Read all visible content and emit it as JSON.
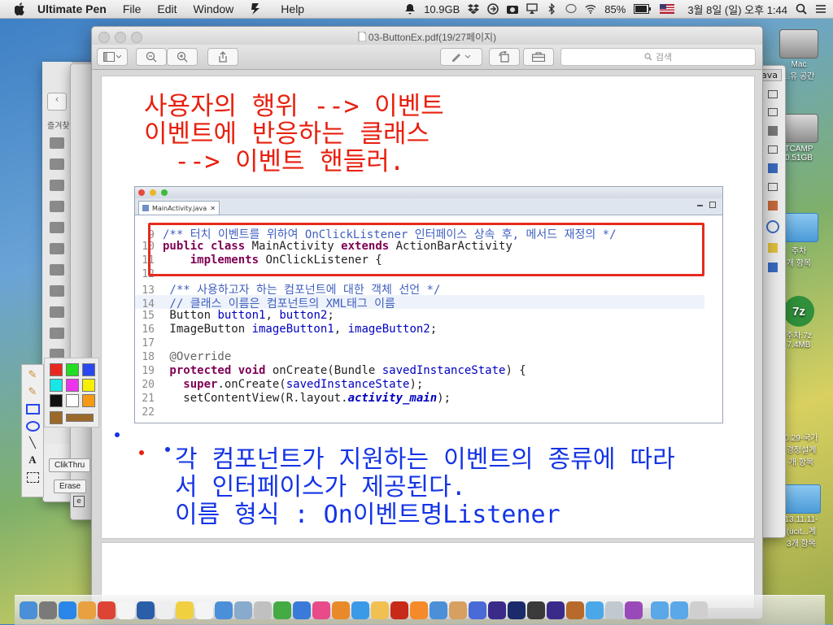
{
  "menubar": {
    "app_name": "Ultimate Pen",
    "menus": [
      "File",
      "Edit",
      "Window",
      "Help"
    ],
    "status": {
      "disk": "10.9GB",
      "battery": "85%",
      "datetime": "3월 8일 (일) 오후 1:44"
    }
  },
  "desktop": {
    "icons": [
      {
        "label": "Mac",
        "sub": "...유 공간"
      },
      {
        "label": "TCAMP",
        "sub": "0.51GB"
      },
      {
        "label": "주차",
        "sub": "개 항목"
      },
      {
        "label": "주차.7z",
        "sub": "7.4MB",
        "badge": "7z"
      },
      {
        "label": "0.29-국가",
        "sub": "경정설계"
      },
      {
        "label": "13.11.11-",
        "sub": "(ucit...계"
      }
    ],
    "icon_extra": {
      "sub2": "개 항목",
      "sub3": "3개 항목"
    }
  },
  "background_windows": {
    "java_tab": "ava",
    "sidebar_heading": "즐겨찾"
  },
  "preview": {
    "title": "03-ButtonEx.pdf(19/27페이지)",
    "search_placeholder": "검색",
    "slide": {
      "heading_lines": [
        "사용자의 행위 --> 이벤트",
        "이벤트에 반응하는 클래스",
        "  --> 이벤트 핸들러."
      ],
      "bullet_lines": [
        "각 컴포넌트가 지원하는 이벤트의 종류에 따라",
        "서 인터페이스가 제공된다.",
        "이름 형식 : On이벤트명Listener"
      ]
    },
    "editor": {
      "tab": "MainActivity.java",
      "lines": [
        {
          "num": "9",
          "text": "/** 터치 이벤트를 위하여 OnClickListener 인터페이스 상속 후, 메서드 재정의 */"
        },
        {
          "num": "10",
          "kw": "public class",
          "text": " MainActivity ",
          "kw2": "extends",
          "text2": " ActionBarActivity"
        },
        {
          "num": "11",
          "kw": "    implements",
          "text": " OnClickListener {"
        },
        {
          "num": "12",
          "text": ""
        },
        {
          "num": "13",
          "text": " /** 사용하고자 하는 컴포넌트에 대한 객체 선언 */"
        },
        {
          "num": "14",
          "text": " // 클래스 이름은 컴포넌트의 XML태그 이름"
        },
        {
          "num": "15",
          "text": " Button ",
          "field": "button1",
          "text2": ", ",
          "field2": "button2",
          "text3": ";"
        },
        {
          "num": "16",
          "text": " ImageButton ",
          "field": "imageButton1",
          "text2": ", ",
          "field2": "imageButton2",
          "text3": ";"
        },
        {
          "num": "17",
          "text": ""
        },
        {
          "num": "18",
          "anno": " @Override"
        },
        {
          "num": "19",
          "kw": " protected void",
          "text": " onCreate(Bundle ",
          "param": "savedInstanceState",
          "text2": ") {"
        },
        {
          "num": "20",
          "kw": "   super",
          "text": ".onCreate(",
          "param": "savedInstanceState",
          "text2": ");"
        },
        {
          "num": "21",
          "text": "   setContentView(R.layout.",
          "field": "activity_main",
          "text2": ");"
        },
        {
          "num": "22",
          "text": ""
        }
      ]
    }
  },
  "pen_palette": {
    "colors": [
      "#e8281e",
      "#22dd22",
      "#2a46ee",
      "#19e7e7",
      "#ee33ee",
      "#f6f000",
      "#111111",
      "#ffffff",
      "#f49a14",
      "#9b6a2a",
      "#9b6a2a"
    ],
    "tooltip_clickthru": "ClikThru",
    "tooltip_erase": "Erase"
  },
  "dock": {
    "items": [
      "finder",
      "launchpad",
      "safari",
      "photos",
      "chrome",
      "calendar",
      "reminders",
      "clock",
      "notes",
      "lists",
      "finder2",
      "preview",
      "photos2",
      "numbers",
      "keynote",
      "itunes",
      "ibooks",
      "appstore",
      "folder",
      "filezilla",
      "sublime",
      "folder2",
      "cup",
      "dash",
      "bar",
      "photoshop",
      "sublime2",
      "bar2",
      "box",
      "check",
      "glass",
      "img",
      "trash-folder",
      "folder3",
      "trash"
    ]
  }
}
